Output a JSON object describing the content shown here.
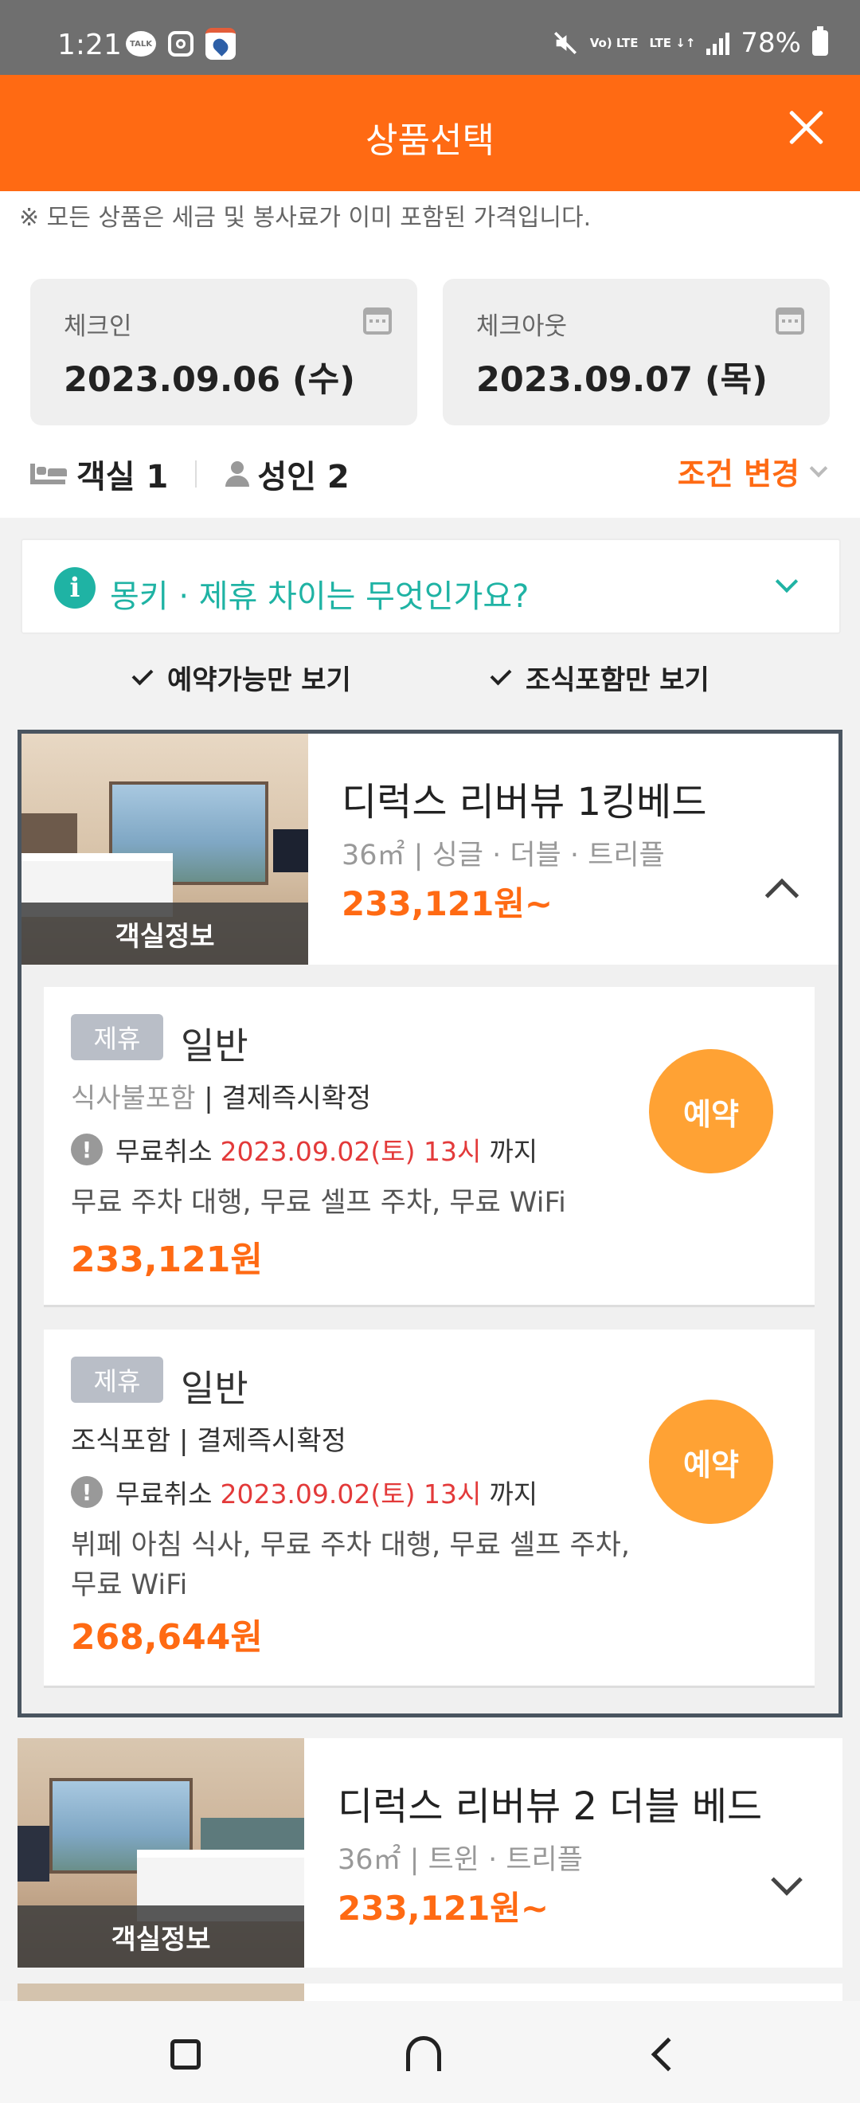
{
  "status_bar": {
    "time": "1:21",
    "icons": [
      "kakaotalk-icon",
      "instagram-icon",
      "app-icon"
    ],
    "network_a": "Vo) LTE",
    "network_b": "LTE ↓↑",
    "battery": "78%"
  },
  "header": {
    "title": "상품선택"
  },
  "notice": "※ 모든 상품은 세금 및 봉사료가 이미 포함된 가격입니다.",
  "dates": {
    "checkin_label": "체크인",
    "checkin_value": "2023.09.06 (수)",
    "checkout_label": "체크아웃",
    "checkout_value": "2023.09.07 (목)"
  },
  "guests": {
    "rooms": "객실 1",
    "adults": "성인 2",
    "change_label": "조건 변경"
  },
  "faq": {
    "text": "몽키 · 제휴 차이는 무엇인가요?"
  },
  "filters": {
    "available_only": "예약가능만 보기",
    "breakfast_only": "조식포함만 보기"
  },
  "rooms": [
    {
      "image_label": "객실정보",
      "name": "디럭스 리버뷰 1킹베드",
      "spec": "36㎡ | 싱글 · 더블 · 트리플",
      "price": "233,121원~",
      "expanded": true,
      "offers": [
        {
          "tag": "제휴",
          "type": "일반",
          "meal": "식사불포함",
          "payment": "| 결제즉시확정",
          "cancel_prefix": "무료취소",
          "cancel_date": "2023.09.02(토) 13시",
          "cancel_suffix": "까지",
          "amenities": "무료 주차 대행, 무료 셀프 주차, 무료 WiFi",
          "price": "233,121원",
          "book_label": "예약"
        },
        {
          "tag": "제휴",
          "type": "일반",
          "meal": "조식포함",
          "payment": "| 결제즉시확정",
          "cancel_prefix": "무료취소",
          "cancel_date": "2023.09.02(토) 13시",
          "cancel_suffix": "까지",
          "amenities": "뷔페 아침 식사, 무료 주차 대행, 무료 셀프 주차, 무료 WiFi",
          "price": "268,644원",
          "book_label": "예약"
        }
      ]
    },
    {
      "image_label": "객실정보",
      "name": "디럭스 리버뷰 2 더블 베드",
      "spec": "36㎡ | 트윈 · 트리플",
      "price": "233,121원~",
      "expanded": false
    }
  ],
  "colors": {
    "brand_orange": "#ff6a13",
    "teal": "#1fb3a4",
    "book_button": "#ffa234",
    "cancel_red": "#e33a3a"
  }
}
